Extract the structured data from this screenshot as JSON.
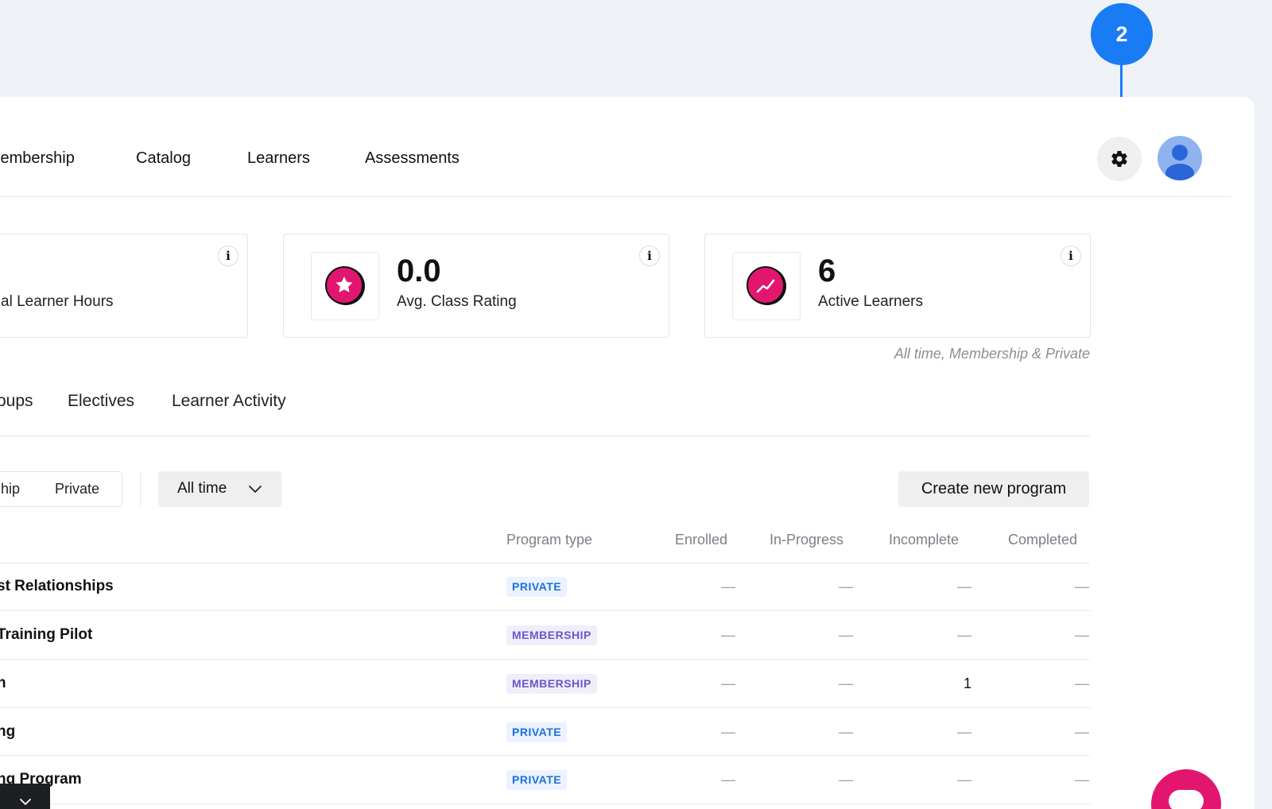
{
  "callout": {
    "number": "2"
  },
  "nav": {
    "items": [
      "lembership",
      "Catalog",
      "Learners",
      "Assessments"
    ]
  },
  "stats": {
    "cards": [
      {
        "value": "",
        "label": "al Learner Hours",
        "icon": "clock-icon"
      },
      {
        "value": "0.0",
        "label": "Avg. Class Rating",
        "icon": "star-icon"
      },
      {
        "value": "6",
        "label": "Active Learners",
        "icon": "trend-icon"
      }
    ],
    "info_glyph": "i",
    "caption": "All time, Membership & Private"
  },
  "tabs": [
    "oups",
    "Electives",
    "Learner Activity"
  ],
  "filters": {
    "segment": [
      "hip",
      "Private"
    ],
    "period": "All time",
    "create_label": "Create new program"
  },
  "table": {
    "headers": [
      "Program type",
      "Enrolled",
      "In-Progress",
      "Incomplete",
      "Completed"
    ],
    "rows": [
      {
        "name": "st Relationships",
        "type": "PRIVATE",
        "enrolled": "—",
        "in_progress": "—",
        "incomplete": "—",
        "completed": "—"
      },
      {
        "name": "Training Pilot",
        "type": "MEMBERSHIP",
        "enrolled": "—",
        "in_progress": "—",
        "incomplete": "—",
        "completed": "—"
      },
      {
        "name": "n",
        "type": "MEMBERSHIP",
        "enrolled": "—",
        "in_progress": "—",
        "incomplete": "1",
        "completed": "—"
      },
      {
        "name": "ng",
        "type": "PRIVATE",
        "enrolled": "—",
        "in_progress": "—",
        "incomplete": "—",
        "completed": "—"
      },
      {
        "name": "ng Program",
        "type": "PRIVATE",
        "enrolled": "—",
        "in_progress": "—",
        "incomplete": "—",
        "completed": "—"
      }
    ]
  },
  "colors": {
    "accent": "#1a7cf5",
    "brand_pink": "#e3166f",
    "private_badge": "#1c6fe0",
    "membership_badge": "#6a57c9"
  }
}
